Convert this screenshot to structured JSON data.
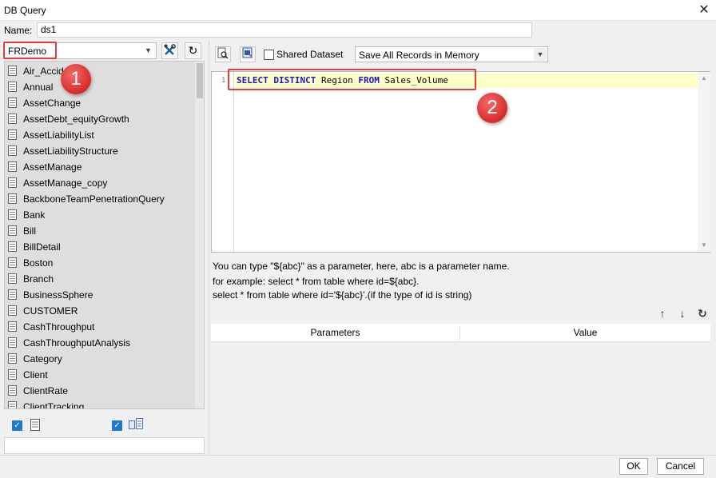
{
  "window": {
    "title": "DB Query"
  },
  "name_row": {
    "label": "Name:",
    "value": "ds1"
  },
  "datasource": {
    "selected": "FRDemo"
  },
  "tables": [
    "Air_Accid",
    "Annual",
    "AssetChange",
    "AssetDebt_equityGrowth",
    "AssetLiabilityList",
    "AssetLiabilityStructure",
    "AssetManage",
    "AssetManage_copy",
    "BackboneTeamPenetrationQuery",
    "Bank",
    "Bill",
    "BillDetail",
    "Boston",
    "Branch",
    "BusinessSphere",
    "CUSTOMER",
    "CashThroughput",
    "CashThroughputAnalysis",
    "Category",
    "Client",
    "ClientRate",
    "ClientTracking"
  ],
  "toolbar": {
    "shared_label": "Shared Dataset",
    "memory_mode": "Save All Records in Memory"
  },
  "editor": {
    "line_number": "1",
    "sql_kw1": "SELECT DISTINCT",
    "sql_t1": " Region ",
    "sql_kw2": "FROM",
    "sql_t2": " Sales_Volume"
  },
  "help": {
    "line1": "You can type \"${abc}\" as a parameter, here, abc is a parameter name.",
    "line2": "for example: select * from table where id=${abc}.",
    "line3": "select * from table where id='${abc}'.(if the type of id is string)"
  },
  "params": {
    "col_name": "Parameters",
    "col_value": "Value"
  },
  "footer": {
    "ok": "OK",
    "cancel": "Cancel"
  },
  "annotations": {
    "badge1": "1",
    "badge2": "2"
  },
  "colors": {
    "annotation_red": "#e23c3c",
    "sql_keyword": "#1818c8",
    "line_highlight": "#fefec7",
    "checkbox_blue": "#1e78d0"
  }
}
